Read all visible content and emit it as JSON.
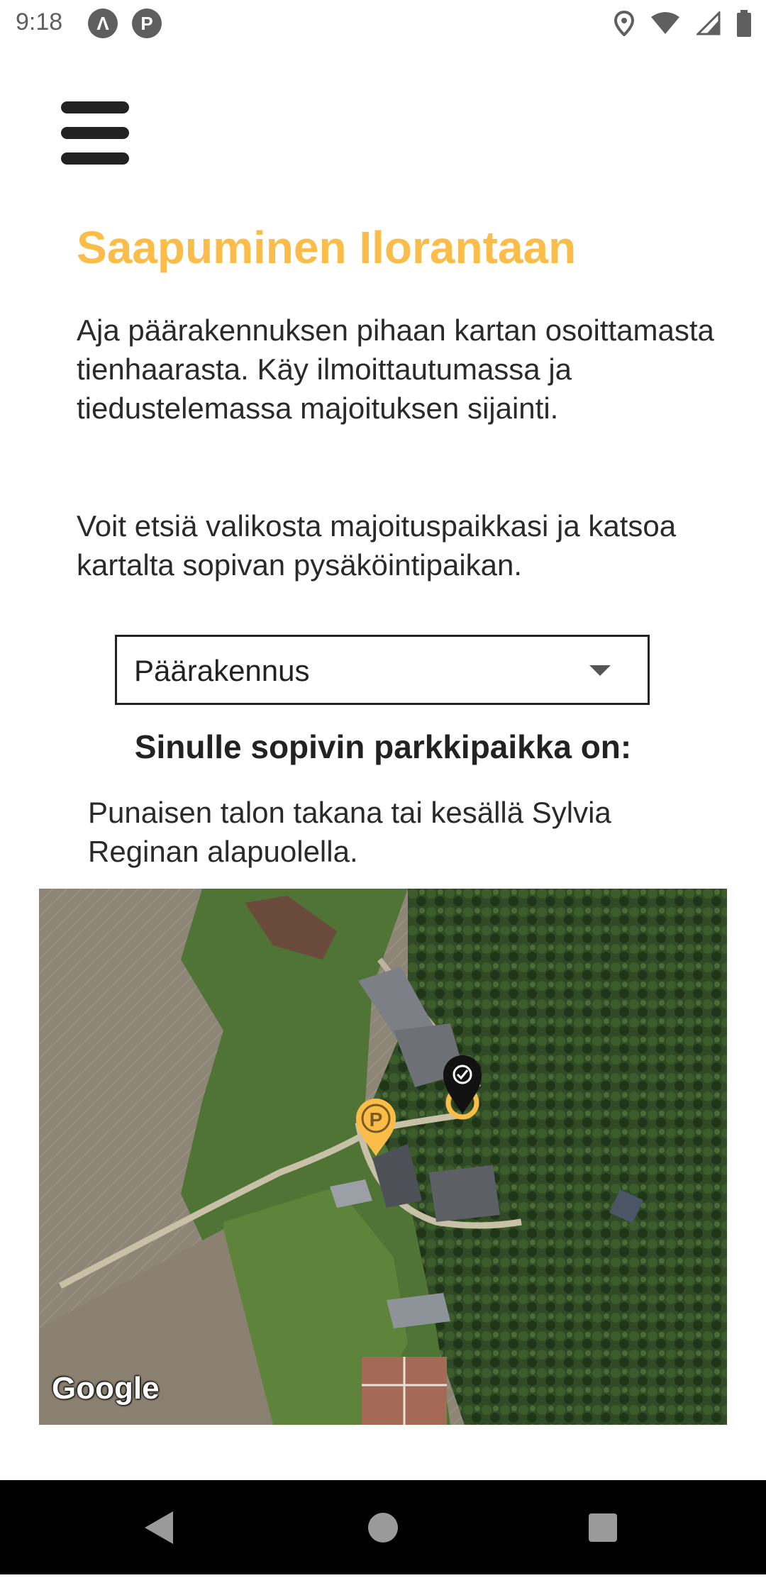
{
  "status_bar": {
    "time": "9:18",
    "app_icons": [
      "Λ",
      "P"
    ],
    "right_icons": [
      "location-icon",
      "wifi-icon",
      "signal-icon",
      "battery-icon"
    ]
  },
  "header": {
    "menu_icon": "hamburger-menu-icon"
  },
  "content": {
    "title": "Saapuminen Ilorantaan",
    "paragraph1": "Aja päärakennuksen pihaan kartan osoittamasta tienhaarasta. Käy ilmoittautumassa ja tiedustelemassa majoituksen sijainti.",
    "paragraph2": "Voit etsiä valikosta majoituspaikkasi ja katsoa kartalta sopivan pysäköintipaikan.",
    "select": {
      "value": "Päärakennus"
    },
    "subheading": "Sinulle sopivin parkkipaikka on:",
    "answer": "Punaisen talon takana tai kesällä Sylvia Reginan alapuolella."
  },
  "map": {
    "attribution": "Google",
    "parking_marker_label": "P",
    "colors": {
      "accent": "#fbbd4a",
      "marker_dark": "#111111"
    }
  },
  "navigation_bar": {
    "buttons": [
      "back-icon",
      "home-icon",
      "recents-icon"
    ]
  },
  "colors": {
    "title": "#fbbd4a",
    "text": "#2a2a2a",
    "navbar": "#000000"
  }
}
